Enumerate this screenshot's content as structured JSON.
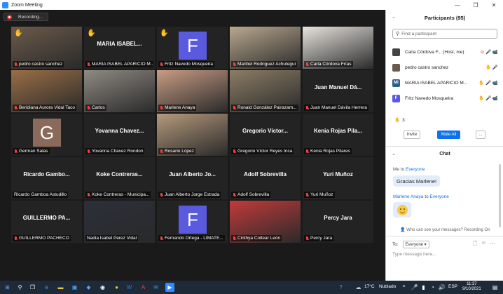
{
  "window": {
    "title": "Zoom Meeting",
    "minimize": "—",
    "maximize": "❐",
    "close": "✕"
  },
  "recording": {
    "label": "Recording..."
  },
  "tiles": [
    {
      "name": "pedro castro sanchez",
      "hand": true,
      "kind": "photo",
      "photo_color": "#6b5a4a"
    },
    {
      "name": "MARIA ISABEL APARICIO M...",
      "big": "MARIA ISABEL...",
      "hand": true,
      "kind": "name"
    },
    {
      "name": "Fritz Navedo Mosqueira",
      "hand": true,
      "kind": "avatar",
      "initial": "F",
      "avatar_color": "#5a5adf"
    },
    {
      "name": "Maribel Rodriguez Achutegui",
      "kind": "photo",
      "active": true,
      "photo_color": "#b9a88e"
    },
    {
      "name": "Carla Córdova Frías",
      "kind": "photo",
      "photo_color": "#e8e4de"
    },
    {
      "name": "Beridiana Aurora Vidal Taco",
      "kind": "photo",
      "photo_color": "#9a6e46"
    },
    {
      "name": "Carlos",
      "kind": "photo",
      "photo_color": "#8f8a83"
    },
    {
      "name": "Marlene Anaya",
      "kind": "photo",
      "photo_color": "#c89c84"
    },
    {
      "name": "Ronald González Pairazam...",
      "kind": "photo",
      "photo_color": "#8c7d65"
    },
    {
      "name": "Juan Manuel Dávila Herrera",
      "big": "Juan Manuel Dá...",
      "kind": "name"
    },
    {
      "name": "German Salas",
      "kind": "avatar",
      "initial": "G",
      "avatar_color": "#8a6a5a"
    },
    {
      "name": "Yovanna Chavez Rondon",
      "big": "Yovanna Chavez...",
      "kind": "name"
    },
    {
      "name": "Rosario López",
      "kind": "photo",
      "photo_color": "#b59a7c"
    },
    {
      "name": "Gregorio Víctor Reyes Inca",
      "big": "Gregorio Víctor...",
      "kind": "name"
    },
    {
      "name": "Kenia Rojas Pilares",
      "big": "Kenia Rojas Pila...",
      "kind": "name"
    },
    {
      "name": "Ricardo Gamboa Astudillo",
      "big": "Ricardo Gambo...",
      "kind": "name",
      "nomute": true
    },
    {
      "name": "Koke Contreras - Municipa...",
      "big": "Koke Contreras...",
      "kind": "name"
    },
    {
      "name": "Juan Alberto Jorge Estrada",
      "big": "Juan Alberto Jo...",
      "kind": "name"
    },
    {
      "name": "Adolf Sobrevilla",
      "big": "Adolf Sobrevilla",
      "kind": "name"
    },
    {
      "name": "Yuri Muñoz",
      "big": "Yuri Muñoz",
      "kind": "name"
    },
    {
      "name": "GUILLERMO PACHECO",
      "big": "GUILLERMO PA...",
      "kind": "name"
    },
    {
      "name": "Nadia Isabel Perez Vidal",
      "kind": "photo",
      "photo_color": "#2c2f3a",
      "nomute": true
    },
    {
      "name": "Fernando Ortega - LIMATE...",
      "kind": "avatar",
      "initial": "F",
      "avatar_color": "#5a5adf"
    },
    {
      "name": "Cinthya Cotlear León",
      "kind": "photo",
      "photo_color": "#c23a3a"
    },
    {
      "name": "Percy Jara",
      "big": "Percy Jara",
      "kind": "name"
    }
  ],
  "participants": {
    "title": "Participants (95)",
    "search_placeholder": "Find a participant",
    "list": [
      {
        "name": "Carla Córdova F... (Host, me)",
        "initial": "",
        "color": "#444",
        "icons": "⊘ 🎤 📹"
      },
      {
        "name": "pedro castro sanchez",
        "initial": "",
        "color": "#6b5a4a",
        "icons": "✋ 🎤"
      },
      {
        "name": "MARIA ISABEL APARICIO M...",
        "initial": "MI",
        "color": "#2d5b8c",
        "icons": "✋ 🎤 📹"
      },
      {
        "name": "Fritz Navedo Mosqueira",
        "initial": "F",
        "color": "#5a5adf",
        "icons": "✋ 🎤 📹"
      }
    ],
    "raised_count": "3",
    "invite": "Invite",
    "mute_all": "Mute All",
    "more": "..."
  },
  "chat": {
    "title": "Chat",
    "msg1_from": "Me",
    "msg1_to_word": "to",
    "msg1_to": "Everyone",
    "msg1_text": "Gracias Marlene!",
    "msg2_from": "Marlene Anaya",
    "msg2_to_word": "to",
    "msg2_to": "Everyone",
    "who_can_see": "Who can see your messages? Recording On",
    "to_label": "To:",
    "to_value": "Everyone ▾",
    "input_placeholder": "Type message here..."
  },
  "taskbar": {
    "temperature": "17°C",
    "weather": "Nublado",
    "lang": "ESP",
    "time": "11:37",
    "date": "9/10/2021"
  }
}
